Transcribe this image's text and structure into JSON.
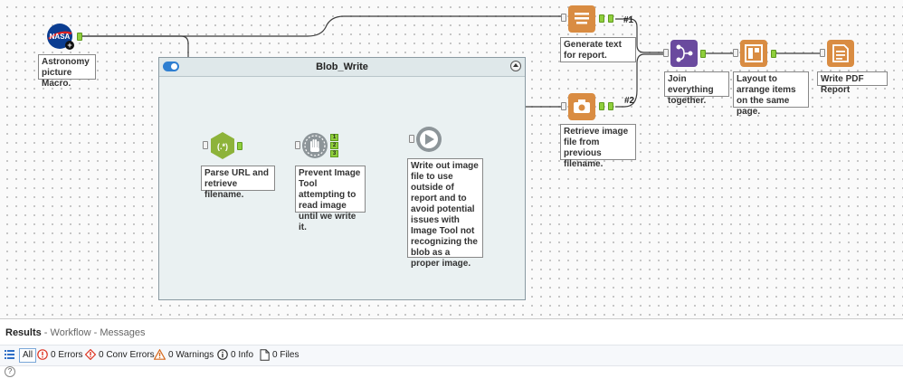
{
  "container": {
    "title": "Blob_Write"
  },
  "notes": {
    "astronomy": "Astronomy picture Macro.",
    "generate_text": "Generate text for report.",
    "retrieve_image": "Retrieve image file from previous filename.",
    "join": "Join everything together.",
    "layout": "Layout to arrange items on the same page.",
    "write_pdf": "Write PDF Report",
    "parse_url": "Parse URL and retrieve filename.",
    "prevent_image": "Prevent Image Tool attempting to read image until we write it.",
    "write_out": "Write out image file to use outside of report and to avoid potential issues with Image Tool not recognizing the blob as a proper image."
  },
  "tools": {
    "macro_logo_text": "NASA",
    "regex_symbol": "(.*)",
    "block_outputs": [
      "1",
      "2",
      "3"
    ]
  },
  "connections": {
    "label_1": "#1",
    "label_2": "#2"
  },
  "results": {
    "title": "Results",
    "subtitle": " - Workflow - Messages",
    "filters": {
      "all": "All",
      "errors": "0 Errors",
      "conv_errors": "0 Conv Errors",
      "warnings": "0 Warnings",
      "info": "0 Info",
      "files": "0 Files"
    },
    "help": "?"
  },
  "colors": {
    "reporting_tool": "#d98c42",
    "union_tool": "#6a4a9e",
    "parse_tool": "#8db33a",
    "developer_tool": "#8d9599",
    "anchor": "#8fce3c",
    "nasa_blue": "#0b3d91"
  }
}
